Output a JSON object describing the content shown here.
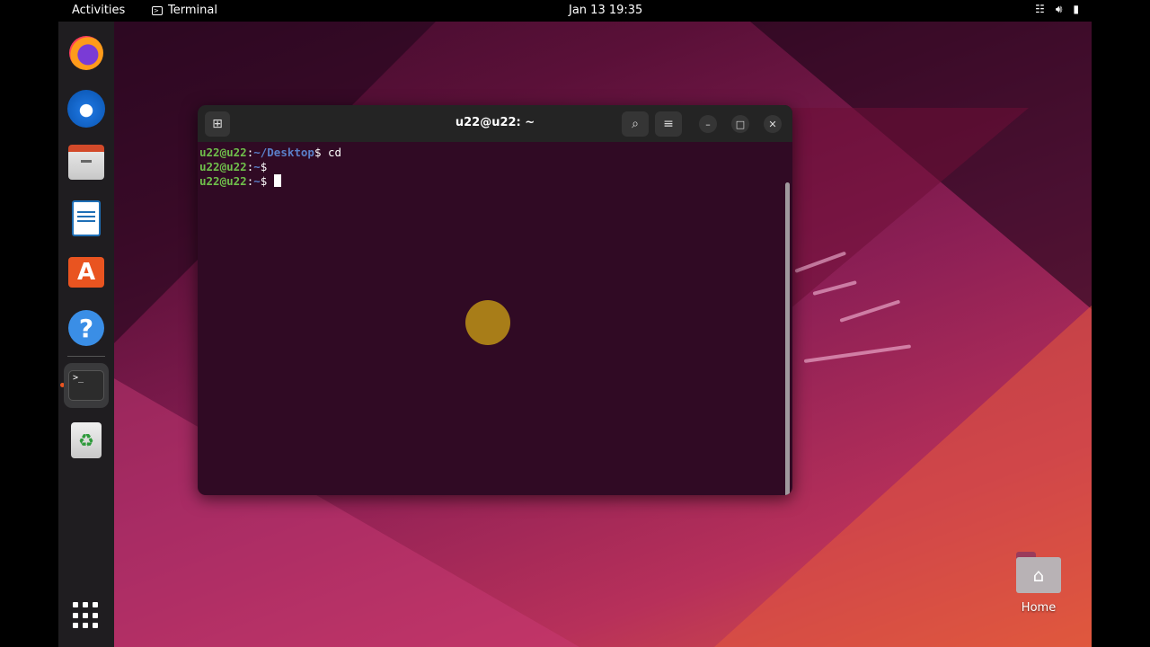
{
  "topbar": {
    "activities": "Activities",
    "app_name": "Terminal",
    "clock": "Jan 13  19:35",
    "tray_icons": [
      "network-icon",
      "volume-icon",
      "battery-icon"
    ]
  },
  "dock": {
    "items": [
      {
        "name": "firefox",
        "icon": "firefox-icon"
      },
      {
        "name": "thunderbird",
        "icon": "thunderbird-icon"
      },
      {
        "name": "files",
        "icon": "files-icon"
      },
      {
        "name": "libreoffice-writer",
        "icon": "writer-icon"
      },
      {
        "name": "app-center",
        "icon": "appstore-icon",
        "glyph": "A"
      },
      {
        "name": "help",
        "icon": "help-icon",
        "glyph": "?"
      },
      {
        "name": "terminal",
        "icon": "terminal-icon",
        "glyph": ">_",
        "active": true
      },
      {
        "name": "trash",
        "icon": "trash-icon",
        "glyph": "♻"
      }
    ],
    "show_apps_icon": "apps-grid-icon"
  },
  "terminal": {
    "title": "u22@u22: ~",
    "lines": [
      {
        "host": "u22@u22",
        "sep": ":",
        "path": "~/Desktop",
        "prompt": "$ ",
        "command": "cd"
      },
      {
        "host": "u22@u22",
        "sep": ":",
        "path": "~",
        "prompt": "$ ",
        "command": ""
      },
      {
        "host": "u22@u22",
        "sep": ":",
        "path": "~",
        "prompt": "$ ",
        "command": ""
      }
    ],
    "buttons": {
      "new_tab": "new-tab-icon",
      "search": "search-icon",
      "menu": "hamburger-menu-icon",
      "minimize": "minimize-icon",
      "maximize": "maximize-icon",
      "close": "close-icon"
    }
  },
  "desktop": {
    "home_label": "Home"
  },
  "colors": {
    "terminal_bg": "#300a24",
    "prompt_host": "#6fbf4b",
    "prompt_path": "#5a7fc8",
    "accent": "#e95420"
  }
}
